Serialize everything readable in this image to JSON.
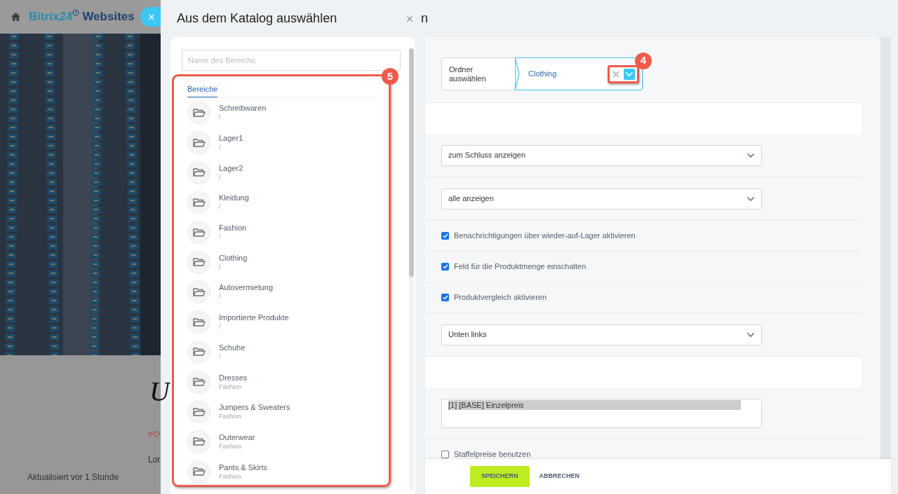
{
  "background_page": {
    "logo": {
      "brand": "Bitrix24",
      "product": "Websites"
    },
    "heading_fragment": "U",
    "text_fragment": "Lor",
    "updated": "Aktualisiert vor 1 Stunde",
    "close_label": "×"
  },
  "slider": {
    "title": "Aus dem Katalog auswählen",
    "close_label": "×",
    "behind_title_fragment": "n"
  },
  "catalog": {
    "search": {
      "placeholder": "Name des Bereichs"
    },
    "callout": "5",
    "tabs": [
      {
        "label": "Bereiche",
        "selected": true
      }
    ],
    "sections": [
      {
        "name": "Schreibwaren",
        "path": "/"
      },
      {
        "name": "Lager1",
        "path": "/"
      },
      {
        "name": "Lager2",
        "path": "/"
      },
      {
        "name": "Kleidung",
        "path": "/"
      },
      {
        "name": "Fashion",
        "path": "/"
      },
      {
        "name": "Clothing",
        "path": "/"
      },
      {
        "name": "Autovermietung",
        "path": "/"
      },
      {
        "name": "Importierte Produkte",
        "path": "/"
      },
      {
        "name": "Schuhe",
        "path": "/"
      },
      {
        "name": "Dresses",
        "path": "Fashion"
      },
      {
        "name": "Jumpers & Sweaters",
        "path": "Fashion"
      },
      {
        "name": "Outerwear",
        "path": "Fashion"
      },
      {
        "name": "Pants & Skirts",
        "path": "Fashion"
      }
    ]
  },
  "form": {
    "folder_picker": {
      "label": "Ordner auswählen",
      "value": "Clothing",
      "callout": "4"
    },
    "rows": [
      {
        "kind": "blank"
      },
      {
        "kind": "select",
        "value": "zum Schluss anzeigen"
      },
      {
        "kind": "select",
        "value": "alle anzeigen"
      },
      {
        "kind": "checkbox",
        "label": "Benachrichtigungen über wieder-auf-Lager aktivieren",
        "checked": true
      },
      {
        "kind": "checkbox",
        "label": "Feld für die Produktmenge einschalten",
        "checked": true
      },
      {
        "kind": "checkbox",
        "label": "Produktvergleich aktivieren",
        "checked": true
      },
      {
        "kind": "select",
        "value": "Unten links"
      },
      {
        "kind": "blank"
      },
      {
        "kind": "listbox",
        "options": [
          {
            "label": "[1] [BASE] Einzelpreis",
            "selected": true
          }
        ]
      },
      {
        "kind": "checkbox",
        "label": "Staffelpreise benutzen",
        "checked": false
      }
    ]
  },
  "footer": {
    "buttons": [
      {
        "label": "SPEICHERN",
        "kind": "primary"
      },
      {
        "label": "ABBRECHEN",
        "kind": "link"
      }
    ]
  }
}
